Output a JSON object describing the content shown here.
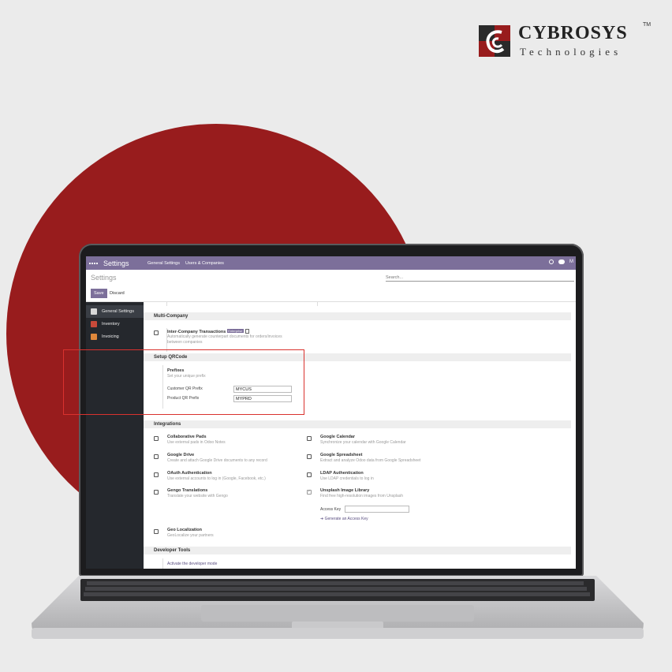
{
  "brand": {
    "name": "CYBROSYS",
    "tm": "TM",
    "subtitle": "Technologies"
  },
  "app": {
    "title": "Settings",
    "menu": [
      "General Settings",
      "Users & Companies"
    ],
    "user_initial": "M"
  },
  "control_panel": {
    "breadcrumb": "Settings",
    "search_placeholder": "Search...",
    "save_label": "Save",
    "discard_label": "Discard"
  },
  "sidebar": {
    "items": [
      {
        "label": "General Settings",
        "icon": "settings-icon"
      },
      {
        "label": "Inventory",
        "icon": "inventory-icon"
      },
      {
        "label": "Invoicing",
        "icon": "invoicing-icon"
      }
    ]
  },
  "multi_company": {
    "header": "Multi-Company",
    "title": "Inter-Company Transactions",
    "badge": "Enterprise",
    "desc_line1": "Automatically generate counterpart documents for orders/invoices",
    "desc_line2": "between companies"
  },
  "qrcode": {
    "header": "Setup QRCode",
    "title": "Prefixes",
    "desc": "Set your unique prefix",
    "customer_label": "Customer QR Prefix",
    "customer_value": "MYCUS",
    "product_label": "Product QR Prefix",
    "product_value": "MYPRD"
  },
  "integrations": {
    "header": "Integrations",
    "items": [
      {
        "title": "Collaborative Pads",
        "desc": "Use external pads in Odoo Notes",
        "checked": false
      },
      {
        "title": "Google Calendar",
        "desc": "Synchronize your calendar with Google Calendar",
        "checked": false
      },
      {
        "title": "Google Drive",
        "desc": "Create and attach Google Drive documents to any record",
        "checked": false
      },
      {
        "title": "Google Spreadsheet",
        "desc": "Extract and analyze Odoo data from Google Spreadsheet",
        "checked": false
      },
      {
        "title": "OAuth Authentication",
        "desc": "Use external accounts to log in (Google, Facebook, etc.)",
        "checked": false
      },
      {
        "title": "LDAP Authentication",
        "desc": "Use LDAP credentials to log in",
        "checked": false
      },
      {
        "title": "Gengo Translations",
        "desc": "Translate your website with Gengo",
        "checked": false
      },
      {
        "title": "Unsplash Image Library",
        "desc": "Find free high-resolution images from Unsplash",
        "checked": true
      },
      {
        "title": "Geo Localization",
        "desc": "GeoLocalize your partners",
        "checked": false
      }
    ],
    "access_key_label": "Access Key",
    "generate_link": "Generate an Access Key"
  },
  "developer": {
    "header": "Developer Tools",
    "link": "Activate the developer mode"
  },
  "colors": {
    "brand_red": "#981c1d",
    "odoo_purple": "#7c6f9a",
    "highlight_red": "#d9322e"
  }
}
